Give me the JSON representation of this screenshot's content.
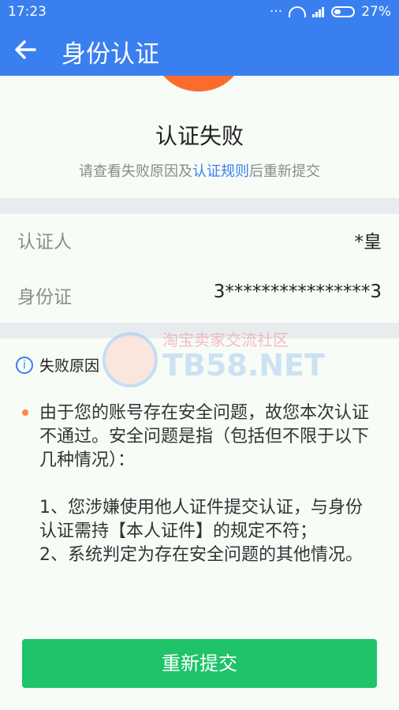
{
  "status_bar": {
    "time": "17:23",
    "battery": "27%"
  },
  "header": {
    "title": "身份认证",
    "back_icon": "arrow-left-icon"
  },
  "result": {
    "title": "认证失败",
    "desc_prefix": "请查看失败原因及",
    "desc_link": "认证规则",
    "desc_suffix": "后重新提交",
    "accent_color": "#fb6b2e",
    "link_color": "#3a7ff0"
  },
  "info": {
    "rows": [
      {
        "label": "认证人",
        "value": "*皇"
      },
      {
        "label": "身份证",
        "value": "3****************3"
      }
    ]
  },
  "reason": {
    "header": "失败原因",
    "text": "由于您的账号存在安全问题，故您本次认证不通过。安全问题是指（包括但不限于以下几种情况）：\n\n1、您涉嫌使用他人证件提交认证，与身份认证需持【本人证件】的规定不符；\n2、系统判定为存在安全问题的其他情况。"
  },
  "watermark": {
    "cn": "淘宝卖家交流社区",
    "en": "TB58.NET"
  },
  "button": {
    "label": "重新提交",
    "color": "#1fc36a"
  }
}
